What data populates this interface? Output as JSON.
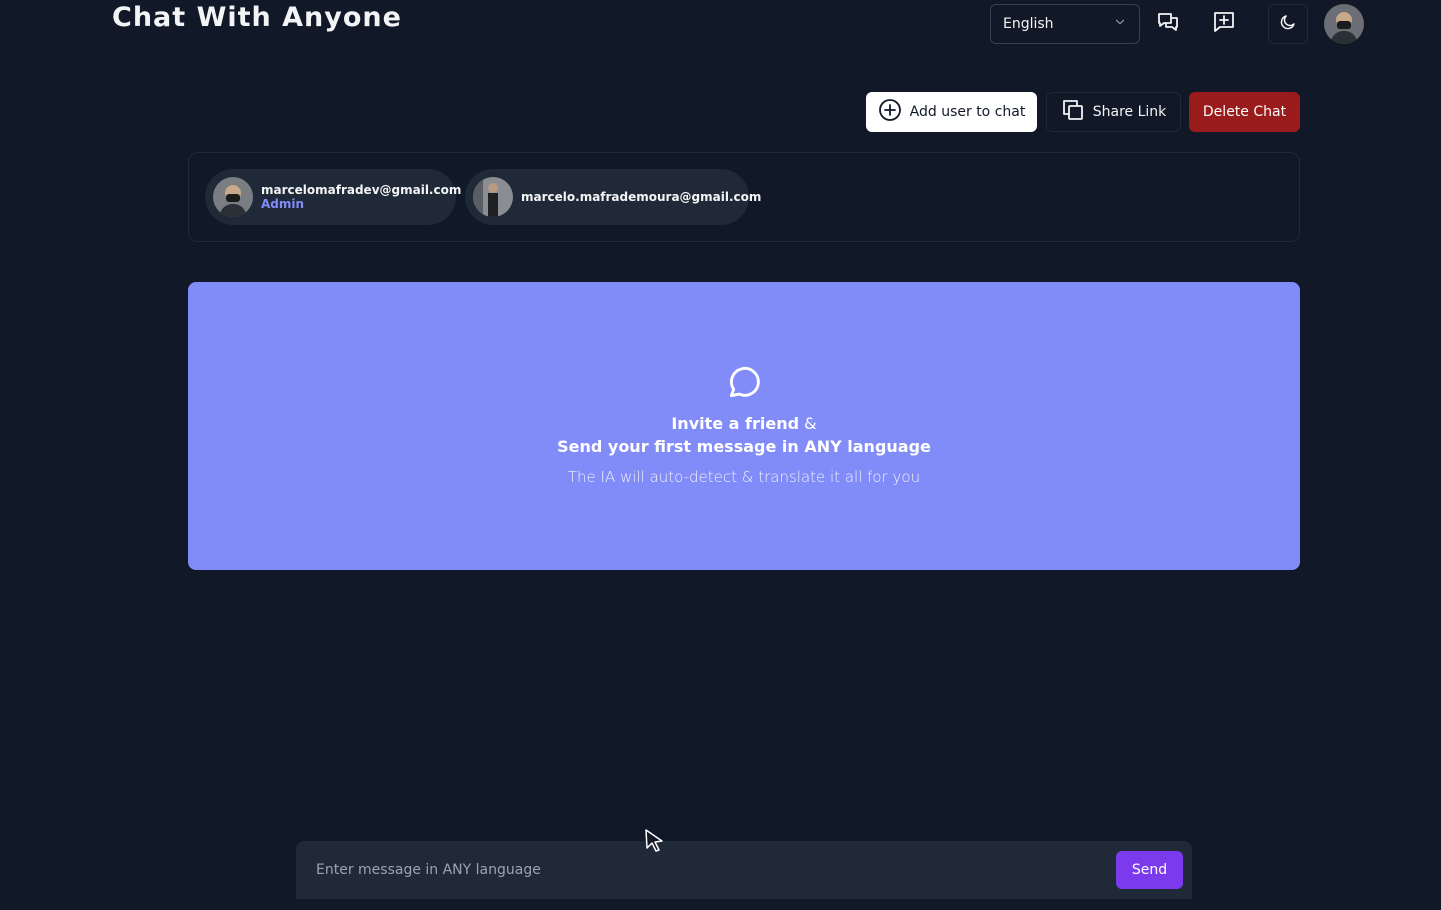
{
  "header": {
    "logo": "Chat With Anyone",
    "language": "English"
  },
  "actions": {
    "add_user": "Add user to chat",
    "share_link": "Share Link",
    "delete_chat": "Delete Chat"
  },
  "members": [
    {
      "email": "marcelomafradev@gmail.com",
      "role": "Admin"
    },
    {
      "email": "marcelo.mafrademoura@gmail.com",
      "role": ""
    }
  ],
  "empty_state": {
    "invite": "Invite a friend",
    "amp": "&",
    "line2": "Send your first message in ANY language",
    "subtitle": "The IA will auto-detect & translate it all for you"
  },
  "composer": {
    "placeholder": "Enter message in ANY language",
    "send_label": "Send"
  },
  "colors": {
    "background": "#111827",
    "accent": "#818cf8",
    "delete": "#991b1b",
    "send": "#7c3aed"
  },
  "icons": [
    "chevron-down-icon",
    "chats-icon",
    "new-chat-icon",
    "moon-icon",
    "plus-circle-icon",
    "copy-icon",
    "message-circle-icon"
  ]
}
